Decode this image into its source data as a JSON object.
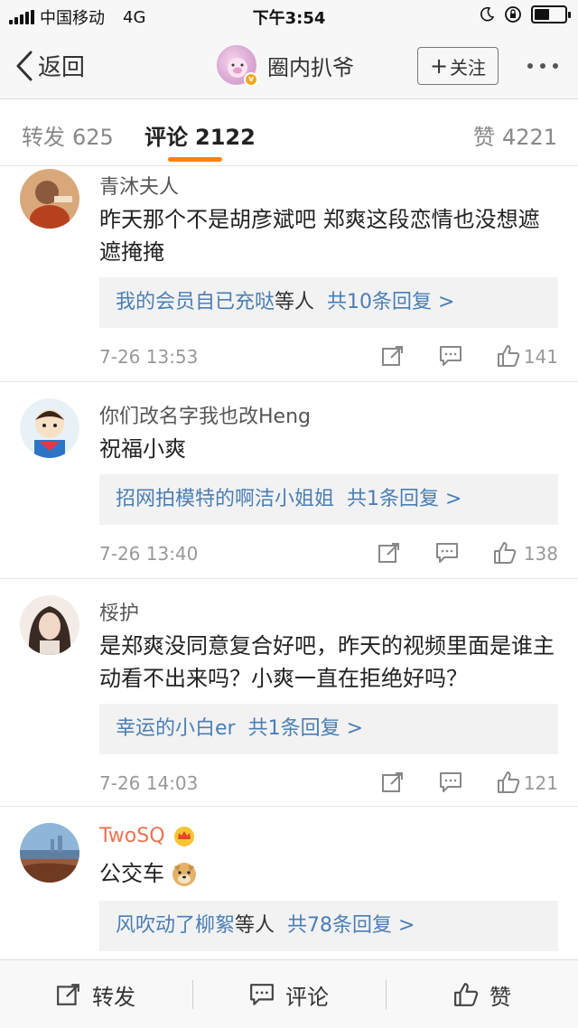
{
  "status_bar": {
    "carrier": "中国移动",
    "network": "4G",
    "time": "下午3:54",
    "battery_level": 0.5
  },
  "nav": {
    "back_label": "返回",
    "title": "圈内扒爷",
    "follow_label": "关注",
    "follow_icon": "+"
  },
  "tabs": [
    {
      "label": "转发",
      "count": "625"
    },
    {
      "label": "评论",
      "count": "2122"
    },
    {
      "label": "赞",
      "count": "4221"
    }
  ],
  "comments": [
    {
      "username": "青沐夫人",
      "text": "昨天那个不是胡彦斌吧  郑爽这段恋情也没想遮遮掩掩",
      "replies_user": "我的会员自已充哒",
      "replies_suffix": "等人",
      "replies_count": "共10条回复 >",
      "time": "7-26 13:53",
      "likes": "141"
    },
    {
      "username": "你们改名字我也改Heng",
      "text": "祝福小爽",
      "replies_user": "招网拍模特的啊洁小姐姐",
      "replies_suffix": "",
      "replies_count": "共1条回复 >",
      "time": "7-26 13:40",
      "likes": "138"
    },
    {
      "username": "桵护",
      "text": "是郑爽没同意复合好吧，昨天的视频里面是谁主动看不出来吗？小爽一直在拒绝好吗？",
      "replies_user": "幸运的小白er",
      "replies_suffix": "",
      "replies_count": "共1条回复 >",
      "time": "7-26 14:03",
      "likes": "121"
    },
    {
      "username": "TwoSQ",
      "text": "公交车",
      "replies_user": "风吹动了柳絮",
      "replies_suffix": "等人",
      "replies_count": "共78条回复 >",
      "time": "",
      "likes": ""
    }
  ],
  "toolbar": {
    "repost_label": "转发",
    "comment_label": "评论",
    "like_label": "赞"
  },
  "colors": {
    "accent": "#ff8200",
    "link": "#4a7fb5",
    "vip_name": "#eb7350"
  }
}
